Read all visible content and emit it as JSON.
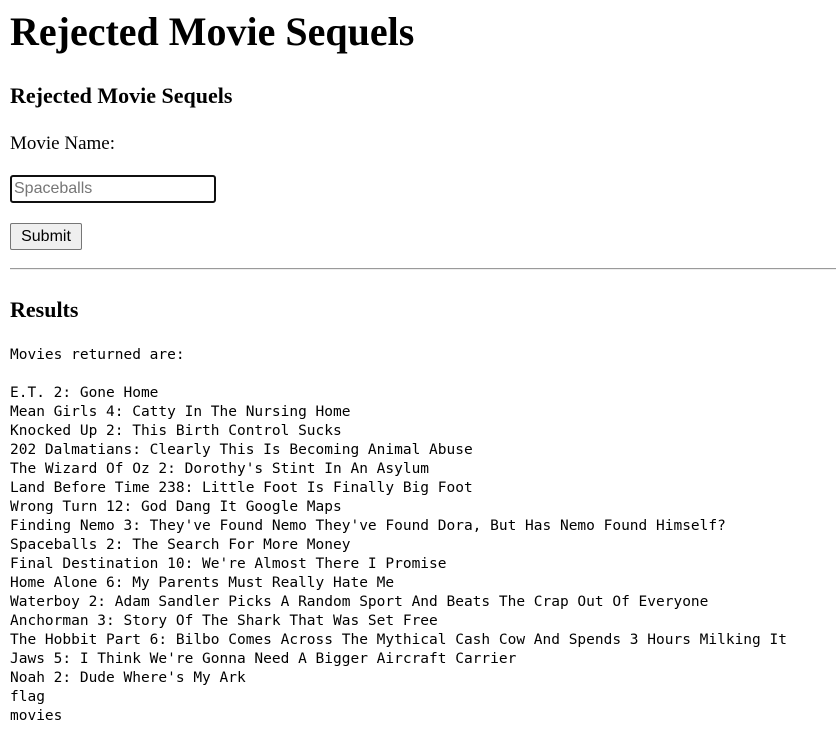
{
  "page": {
    "title": "Rejected Movie Sequels",
    "form_title": "Rejected Movie Sequels",
    "field_label": "Movie Name:",
    "input_value": "",
    "input_placeholder": "Spaceballs",
    "submit_label": "Submit"
  },
  "results": {
    "title": "Results",
    "intro": "Movies returned are:",
    "items": [
      "E.T. 2: Gone Home",
      "Mean Girls 4: Catty In The Nursing Home",
      "Knocked Up 2: This Birth Control Sucks",
      "202 Dalmatians: Clearly This Is Becoming Animal Abuse",
      "The Wizard Of Oz 2: Dorothy's Stint In An Asylum",
      "Land Before Time 238: Little Foot Is Finally Big Foot",
      "Wrong Turn 12: God Dang It Google Maps",
      "Finding Nemo 3: They've Found Nemo They've Found Dora, But Has Nemo Found Himself?",
      "Spaceballs 2: The Search For More Money",
      "Final Destination 10: We're Almost There I Promise",
      "Home Alone 6: My Parents Must Really Hate Me",
      "Waterboy 2: Adam Sandler Picks A Random Sport And Beats The Crap Out Of Everyone",
      "Anchorman 3: Story Of The Shark That Was Set Free",
      "The Hobbit Part 6: Bilbo Comes Across The Mythical Cash Cow And Spends 3 Hours Milking It",
      "Jaws 5: I Think We're Gonna Need A Bigger Aircraft Carrier",
      "Noah 2: Dude Where's My Ark",
      "flag",
      "movies"
    ]
  }
}
